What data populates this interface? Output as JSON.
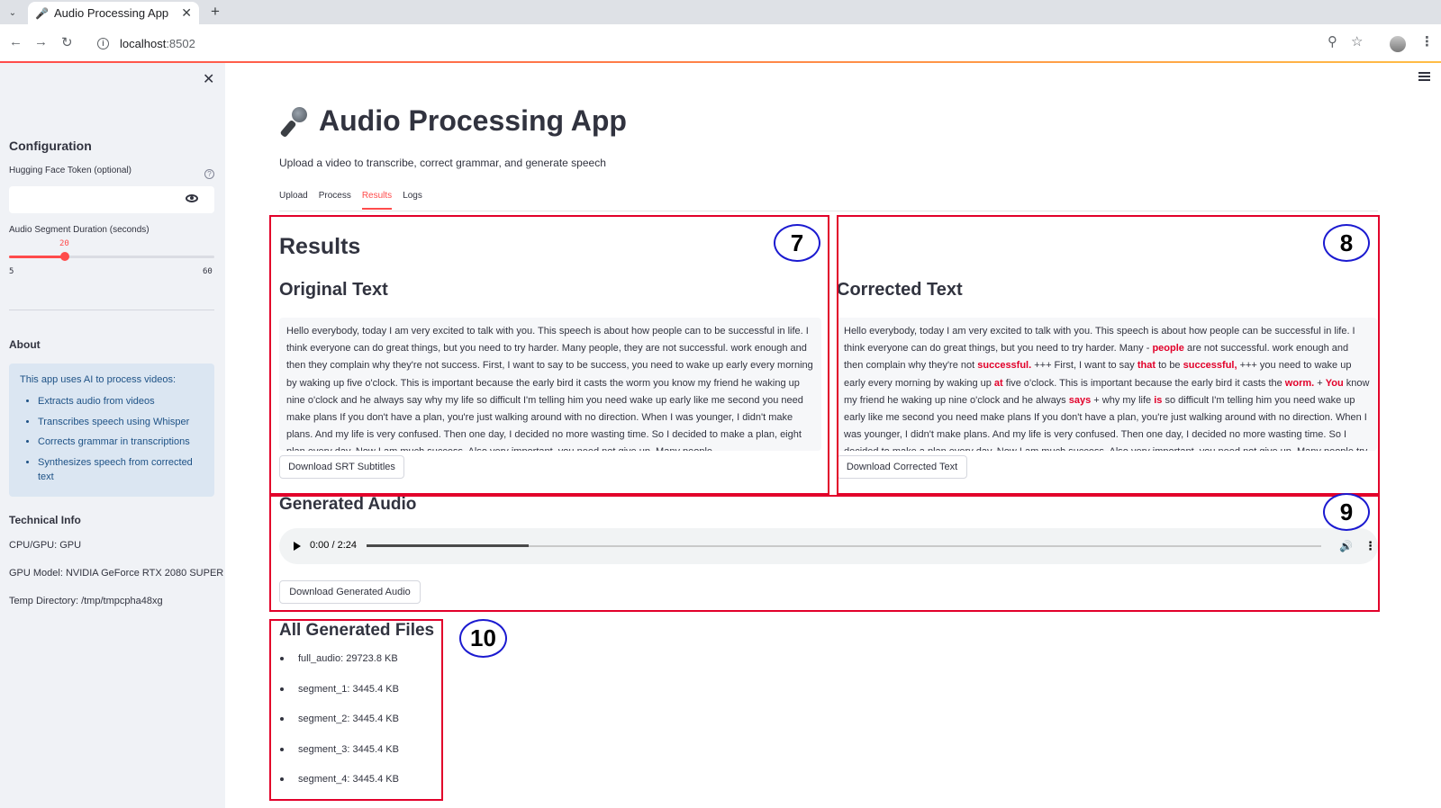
{
  "browser": {
    "tab_title": "Audio Processing App",
    "url_host": "localhost",
    "url_port": ":8502"
  },
  "sidebar": {
    "config_heading": "Configuration",
    "token_label": "Hugging Face Token (optional)",
    "segment_label": "Audio Segment Duration (seconds)",
    "slider": {
      "value": "20",
      "min": "5",
      "max": "60"
    },
    "about_heading": "About",
    "about_intro": "This app uses AI to process videos:",
    "about_items": [
      "Extracts audio from videos",
      "Transcribes speech using Whisper",
      "Corrects grammar in transcriptions",
      "Synthesizes speech from corrected text"
    ],
    "tech_heading": "Technical Info",
    "cpu_gpu": "CPU/GPU: GPU",
    "gpu_model": "GPU Model: NVIDIA GeForce RTX 2080 SUPER",
    "temp_dir": "Temp Directory: /tmp/tmpcpha48xg"
  },
  "main": {
    "title": "Audio Processing App",
    "subtitle": "Upload a video to transcribe, correct grammar, and generate speech",
    "tabs": [
      "Upload",
      "Process",
      "Results",
      "Logs"
    ],
    "active_tab": "Results",
    "results_heading": "Results",
    "original_heading": "Original Text",
    "original_text": "Hello everybody, today I am very excited to talk with you. This speech is about how people can to be successful in life. I think everyone can do great things, but you need to try harder. Many people, they are not successful. work enough and then they complain why they're not success. First, I want to say to be success, you need to wake up early every morning by waking up five o'clock. This is important because the early bird it casts the worm you know my friend he waking up nine o'clock and he always say why my life so difficult I'm telling him you need wake up early like me second you need make plans If you don't have a plan, you're just walking around with no direction. When I was younger, I didn't make plans. And my life is very confused. Then one day, I decided no more wasting time. So I decided to make a plan, eight plan every day. Now I am much success. Also very important, you need not give up. Many people",
    "download_srt": "Download SRT Subtitles",
    "corrected_heading": "Corrected Text",
    "corrected_segments": [
      {
        "t": "Hello everybody, today I am very excited to talk with you. This speech is about how people can be successful in life. I think everyone can do great things, but you need to try harder. Many - ",
        "h": false
      },
      {
        "t": "people",
        "h": true
      },
      {
        "t": " are not successful. work enough and then complain why they're not ",
        "h": false
      },
      {
        "t": "successful.",
        "h": true
      },
      {
        "t": " +++ First, I want to say ",
        "h": false
      },
      {
        "t": "that",
        "h": true
      },
      {
        "t": " to be ",
        "h": false
      },
      {
        "t": "successful,",
        "h": true
      },
      {
        "t": " +++ you need to wake up early every morning by waking up ",
        "h": false
      },
      {
        "t": "at",
        "h": true
      },
      {
        "t": " five o'clock. This is important because the early bird it casts the ",
        "h": false
      },
      {
        "t": "worm.",
        "h": true
      },
      {
        "t": " + ",
        "h": false
      },
      {
        "t": "You",
        "h": true
      },
      {
        "t": " know my friend he waking up nine o'clock and he always ",
        "h": false
      },
      {
        "t": "says",
        "h": true
      },
      {
        "t": " + why my life ",
        "h": false
      },
      {
        "t": "is",
        "h": true
      },
      {
        "t": " so difficult I'm telling him you need wake up early like me second you need make plans If you don't have a plan, you're just walking around with no direction. When I was younger, I didn't make plans. And my life is very confused. Then one day, I decided no more wasting time. So I decided to make a plan every day. Now I am much success. Also very important, you need not give up. Many people try one",
        "h": false
      }
    ],
    "download_corrected": "Download Corrected Text",
    "generated_audio_heading": "Generated Audio",
    "audio_time": "0:00 / 2:24",
    "audio_progress": 0.17,
    "download_audio": "Download Generated Audio",
    "files_heading": "All Generated Files",
    "files": [
      "full_audio: 29723.8 KB",
      "segment_1: 3445.4 KB",
      "segment_2: 3445.4 KB",
      "segment_3: 3445.4 KB",
      "segment_4: 3445.4 KB"
    ]
  },
  "annotations": [
    "7",
    "8",
    "9",
    "10"
  ],
  "colors": {
    "accent": "#ff4b4b",
    "highlight": "#e2002a",
    "annotation_box": "#e2002a",
    "annotation_circle": "#1b1ad0"
  }
}
